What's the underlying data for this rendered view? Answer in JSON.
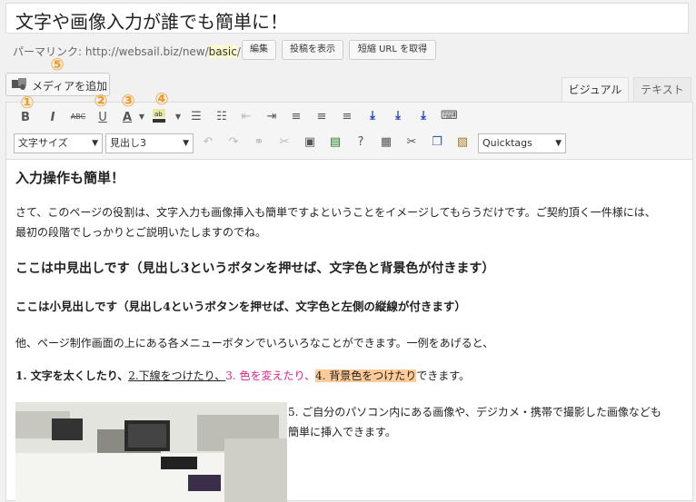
{
  "post": {
    "title": "文字や画像入力が誰でも簡単に！",
    "permalink_label": "パーマリンク: http://websail.biz/new/",
    "permalink_slug": "basic",
    "permalink_tail": "/",
    "edit_button": "編集",
    "view_post_button": "投稿を表示",
    "short_url_button": "短縮 URL を取得"
  },
  "media": {
    "add_label": "メディアを追加"
  },
  "tabs": {
    "visual": "ビジュアル",
    "text": "テキスト"
  },
  "toolbar": {
    "bold": "B",
    "italic": "I",
    "strike": "ABC",
    "underline": "U",
    "color": "A",
    "font_size_select": "文字サイズ",
    "heading_select": "見出し3",
    "quicktags_select": "Quicktags"
  },
  "badges": [
    "①",
    "②",
    "③",
    "④",
    "⑤"
  ],
  "content": {
    "h1": "入力操作も簡単！",
    "p1": "さて、このページの役割は、文字入力も画像挿入も簡単ですよということをイメージしてもらうだけです。ご契約頂く一件様には、",
    "p1b": "最初の段階でしっかりとご説明いたしますのでね。",
    "h2": "ここは中見出しです（見出し3というボタンを押せば、文字色と背景色が付きます）",
    "h3": "ここは小見出しです（見出し4というボタンを押せば、文字色と左側の縦線が付きます）",
    "p2": "他、ページ制作画面の上にある各メニューボタンでいろいろなことができます。一例をあげると、",
    "list_1": "1. 文字を太くしたり、",
    "list_2": "2.下線をつけたり、",
    "list_3": "3. 色を変えたり、",
    "list_4": "4. 背景色をつけたり",
    "list_end": "できます。",
    "p3": "5. ご自分のパソコン内にある画像や、デジカメ・携帯で撮影した画像なども",
    "p3b": "簡単に挿入できます。"
  },
  "colors": {
    "badge": "#f39b22",
    "pink": "#e0208a",
    "highlight": "#ffcc99"
  }
}
